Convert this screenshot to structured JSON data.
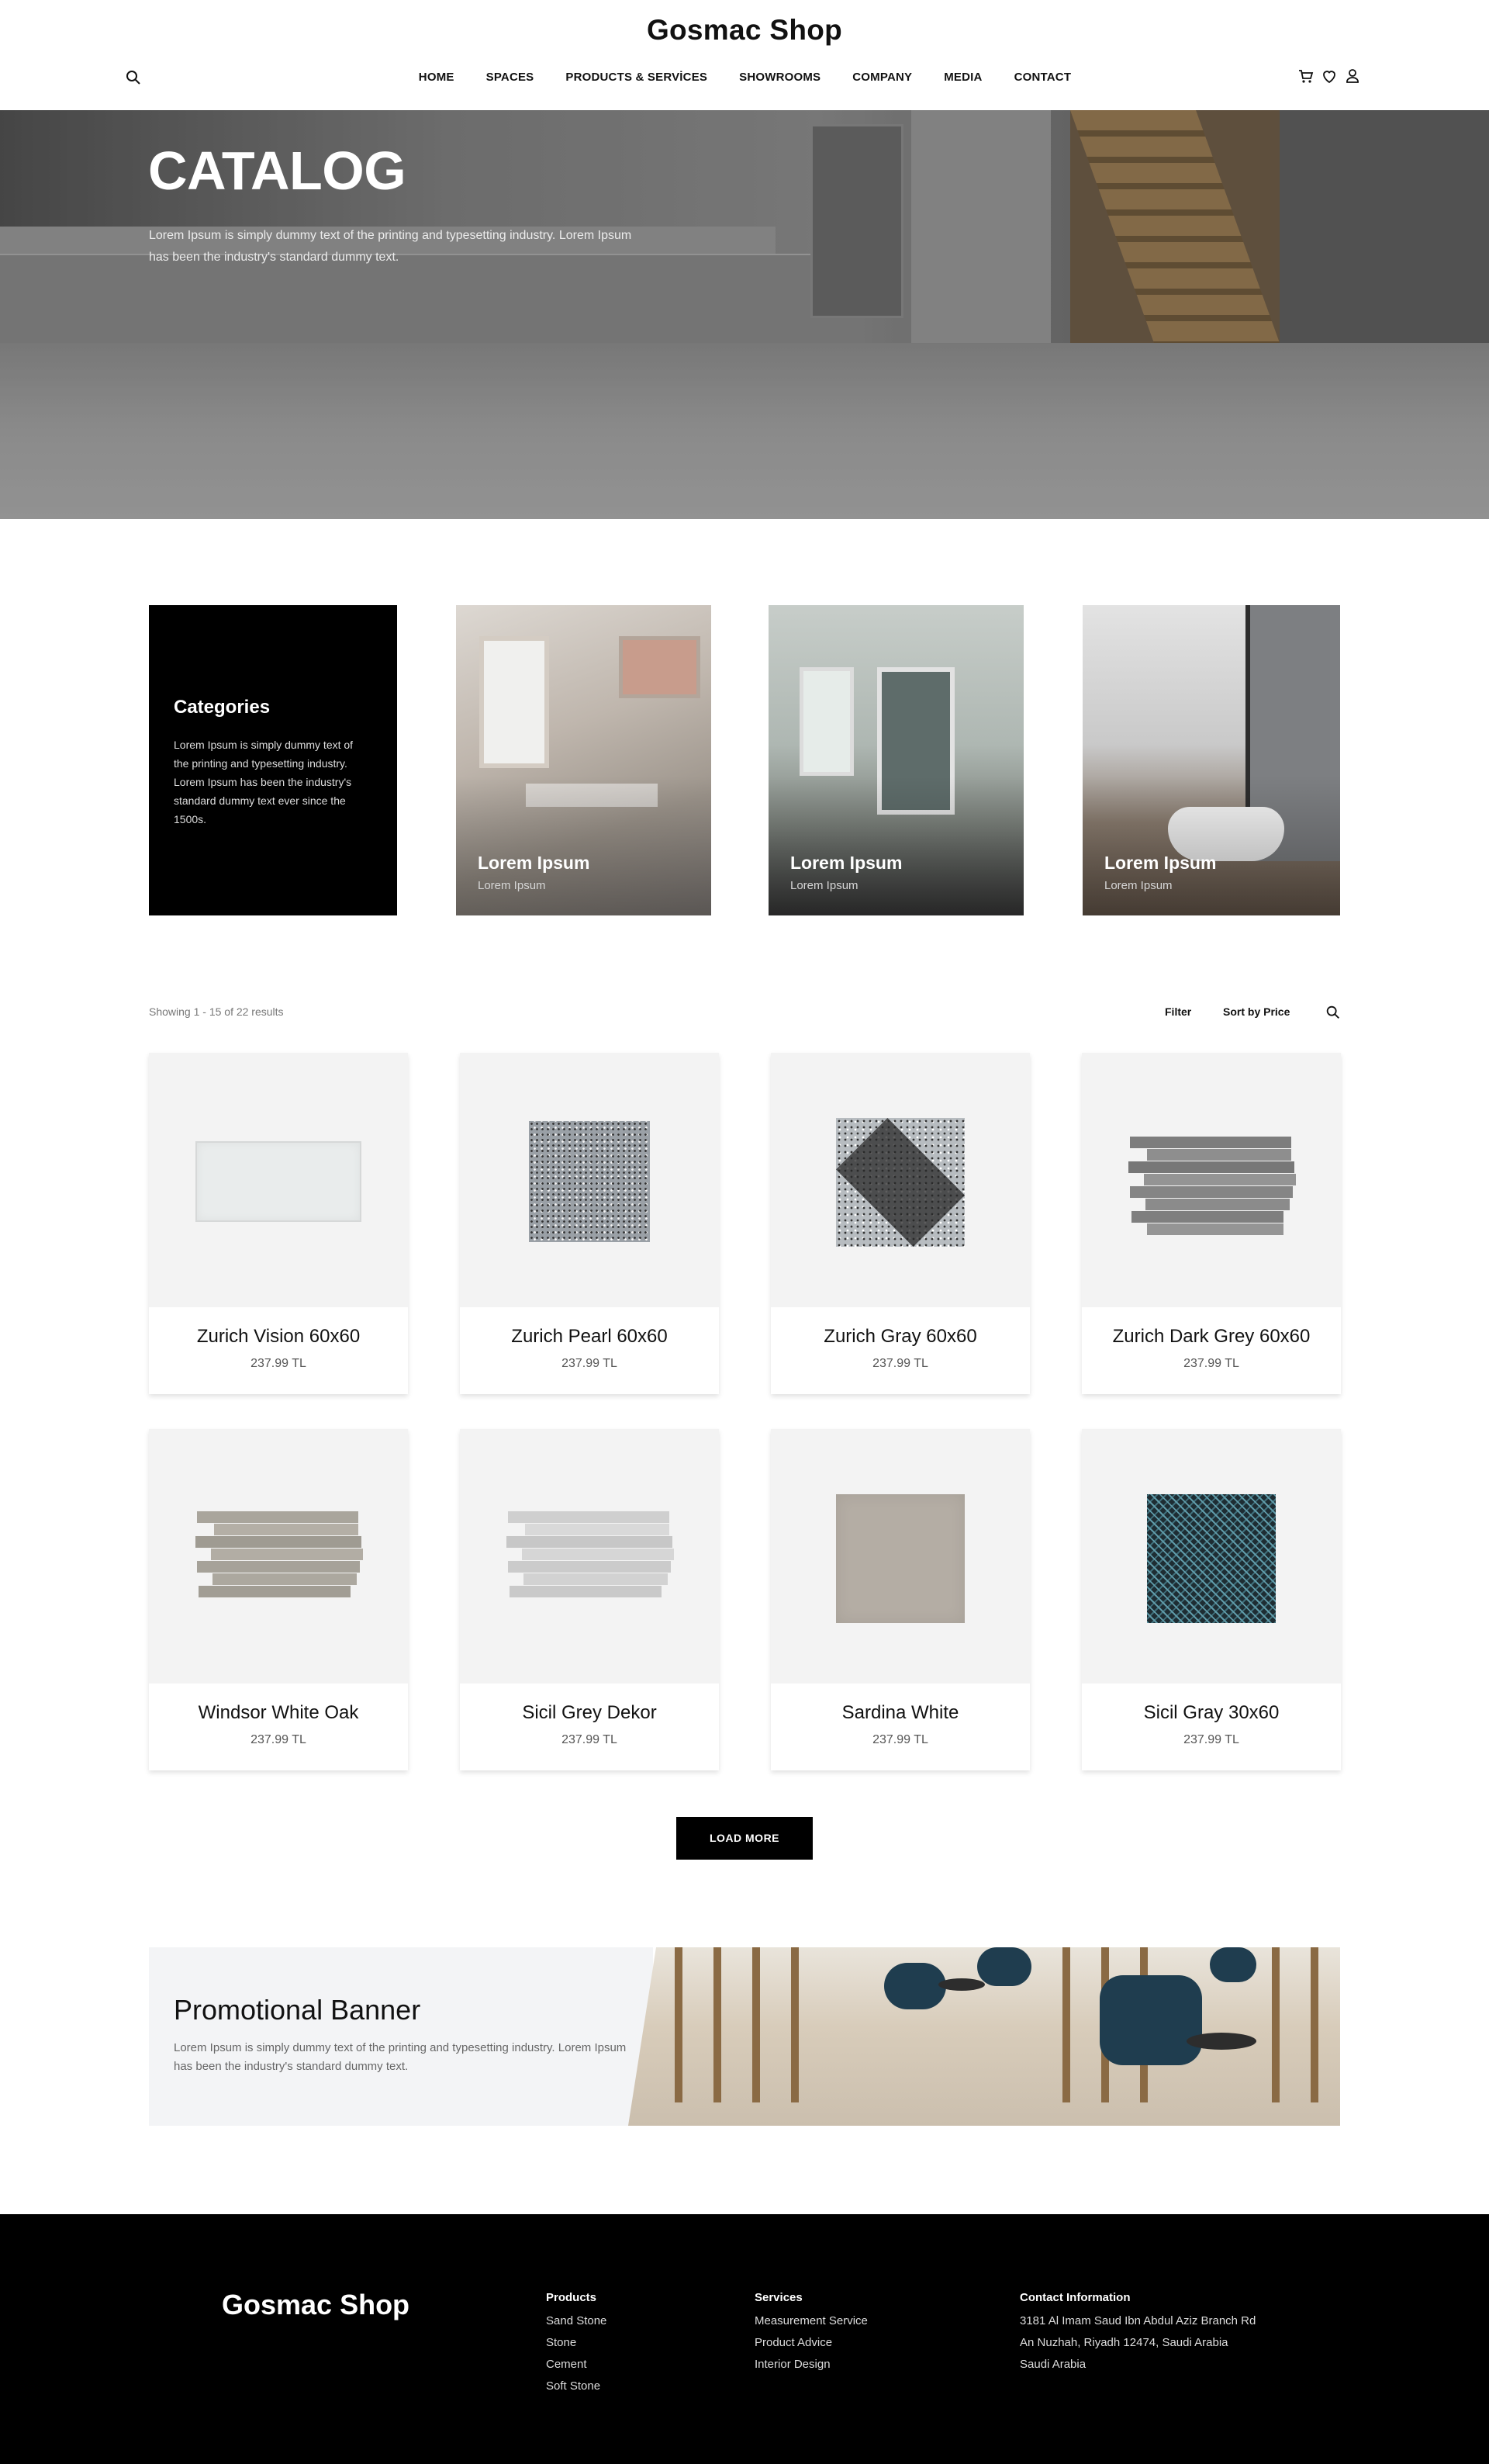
{
  "header": {
    "brand": "Gosmac Shop",
    "nav": [
      "HOME",
      "SPACES",
      "PRODUCTS & SERVİCES",
      "SHOWROOMS",
      "COMPANY",
      "MEDIA",
      "CONTACT"
    ],
    "icons": [
      "search-icon",
      "cart-icon",
      "heart-icon",
      "user-icon"
    ]
  },
  "hero": {
    "title": "CATALOG",
    "text": "Lorem Ipsum is simply dummy text of the printing and typesetting industry. Lorem Ipsum has been the industry's standard dummy text."
  },
  "categories": {
    "title": "Categories",
    "text": "Lorem Ipsum is simply dummy text of the printing and typesetting industry. Lorem Ipsum has been the industry's standard dummy text ever since the 1500s.",
    "cards": [
      {
        "title": "Lorem Ipsum",
        "subtitle": "Lorem Ipsum"
      },
      {
        "title": "Lorem Ipsum",
        "subtitle": "Lorem Ipsum"
      },
      {
        "title": "Lorem Ipsum",
        "subtitle": "Lorem Ipsum"
      }
    ]
  },
  "toolbar": {
    "showing": "Showing 1 - 15 of 22 results",
    "filter": "Filter",
    "sort": "Sort by Price"
  },
  "products": [
    {
      "name": "Zurich Vision 60x60",
      "price": "237.99 TL"
    },
    {
      "name": "Zurich Pearl 60x60",
      "price": "237.99 TL"
    },
    {
      "name": "Zurich Gray 60x60",
      "price": "237.99 TL"
    },
    {
      "name": "Zurich Dark Grey 60x60",
      "price": "237.99 TL"
    },
    {
      "name": "Windsor White Oak",
      "price": "237.99 TL"
    },
    {
      "name": "Sicil Grey Dekor",
      "price": "237.99 TL"
    },
    {
      "name": "Sardina White",
      "price": "237.99 TL"
    },
    {
      "name": "Sicil Gray 30x60",
      "price": "237.99 TL"
    }
  ],
  "load_more": "LOAD MORE",
  "promo": {
    "title": "Promotional Banner",
    "text": "Lorem Ipsum is simply dummy text of the printing and typesetting industry. Lorem Ipsum has been the industry's standard dummy text."
  },
  "footer": {
    "brand": "Gosmac Shop",
    "products": {
      "heading": "Products",
      "items": [
        "Sand Stone",
        "Stone",
        "Cement",
        "Soft Stone"
      ]
    },
    "services": {
      "heading": "Services",
      "items": [
        "Measurement Service",
        "Product Advice",
        "Interior Design"
      ]
    },
    "contact": {
      "heading": "Contact Information",
      "lines": [
        "3181 Al Imam Saud Ibn Abdul Aziz Branch Rd",
        "An Nuzhah, Riyadh 12474, Saudi Arabia",
        "Saudi Arabia"
      ]
    }
  },
  "colors": {
    "accent": "#000000",
    "panel": "#f3f3f3",
    "promo_bg": "#f3f4f6"
  }
}
